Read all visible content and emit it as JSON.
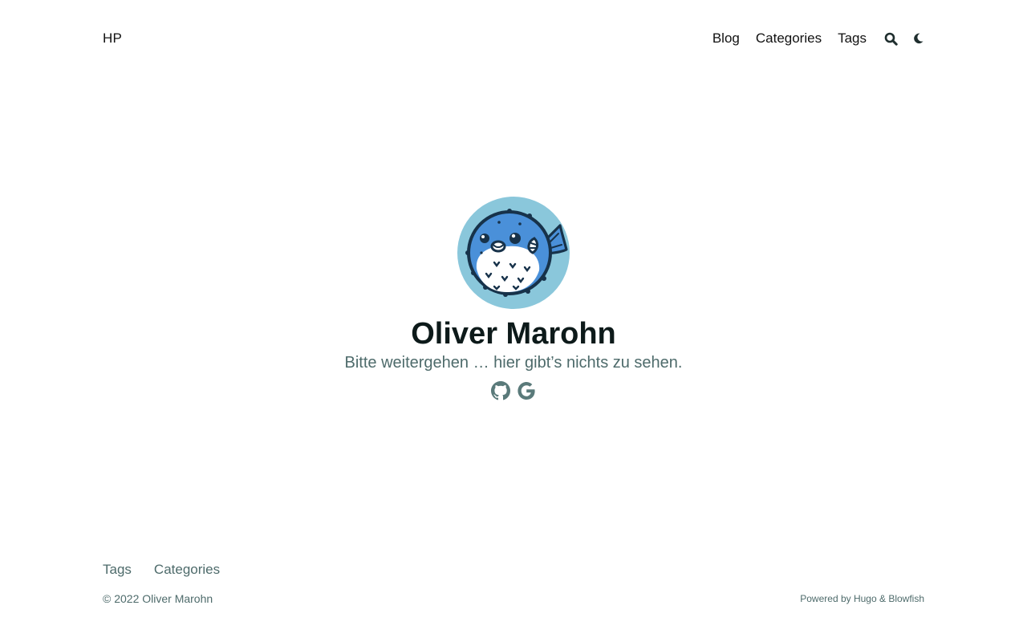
{
  "header": {
    "logo": "HP",
    "nav": [
      {
        "label": "Blog"
      },
      {
        "label": "Categories"
      },
      {
        "label": "Tags"
      }
    ],
    "search_icon": "search-icon",
    "theme_icon": "moon-icon"
  },
  "hero": {
    "avatar_icon": "pufferfish-avatar",
    "name": "Oliver Marohn",
    "headline": "Bitte weitergehen … hier gibt’s nichts zu sehen.",
    "social": [
      {
        "icon": "github-icon"
      },
      {
        "icon": "google-icon"
      }
    ]
  },
  "footer": {
    "menu": [
      {
        "label": "Tags"
      },
      {
        "label": "Categories"
      }
    ],
    "copyright": "© 2022 Oliver Marohn",
    "powered_prefix": "Powered by ",
    "powered_hugo": "Hugo",
    "powered_amp": " & ",
    "powered_blowfish": "Blowfish"
  },
  "colors": {
    "avatar_bg": "#8ac7db",
    "name": "#0d1a1a",
    "muted": "#4e6b6b",
    "icon": "#1f2e2e",
    "social_icon": "#5a7a7a"
  }
}
